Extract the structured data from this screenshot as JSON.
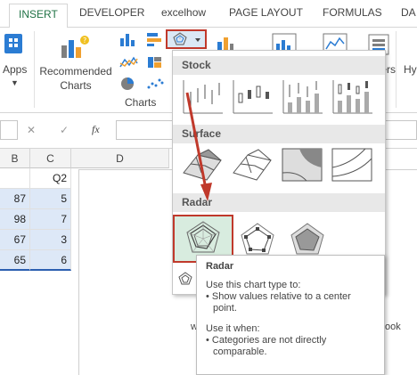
{
  "tabs": [
    "INSERT",
    "DEVELOPER",
    "excelhow",
    "PAGE LAYOUT",
    "FORMULAS",
    "DA"
  ],
  "ribbon": {
    "apps_label": "Apps",
    "recommended_charts_label": [
      "Recommended",
      "Charts"
    ],
    "charts_group_label": "Charts",
    "filters_label": "ters",
    "hy_label": "Hy"
  },
  "formula_bar": {
    "cancel_glyph": "✕",
    "enter_glyph": "✓",
    "fx_glyph": "fx"
  },
  "columns": [
    "B",
    "C",
    "D"
  ],
  "cells": {
    "header_value": "Q2",
    "values": [
      "87",
      "98",
      "67",
      "65"
    ],
    "c_values": [
      "5",
      "7",
      "3",
      "6"
    ]
  },
  "background_text": {
    "left_fragment": "w",
    "right_fragment": "ook"
  },
  "dropdown": {
    "sections": [
      "Stock",
      "Surface",
      "Radar"
    ]
  },
  "tooltip": {
    "title": "Radar",
    "use_to": "Use this chart type to:",
    "bullet1_line1": "• Show values relative to a center",
    "bullet1_line2": "point.",
    "use_when": "Use it when:",
    "bullet2_line1": "• Categories are not directly",
    "bullet2_line2": "comparable."
  },
  "colors": {
    "accent_green": "#217346",
    "highlight_red": "#c0392b",
    "arrow_red": "#c0392b",
    "selected_fill": "#d8ecdf",
    "cell_blue": "#dde8f7"
  },
  "icons": [
    "apps-icon",
    "recommended-charts-icon",
    "radar-chart-icon",
    "stock-chart-icon",
    "surface-chart-icon"
  ]
}
